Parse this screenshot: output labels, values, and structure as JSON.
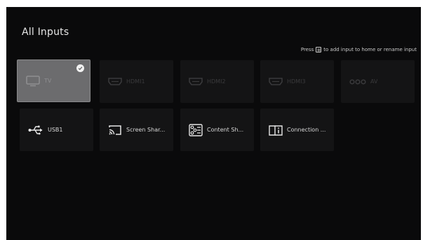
{
  "header": {
    "title": "All Inputs",
    "hint_before": "Press",
    "hint_key_icon": "menu-key-icon",
    "hint_after": "to add input to home or rename input"
  },
  "inputs": [
    {
      "label": "TV",
      "icon": "tv-icon",
      "state": "selected",
      "checked": true
    },
    {
      "label": "HDMI1",
      "icon": "hdmi-icon",
      "state": "disabled"
    },
    {
      "label": "HDMI2",
      "icon": "hdmi-icon",
      "state": "disabled"
    },
    {
      "label": "HDMI3",
      "icon": "hdmi-icon",
      "state": "disabled"
    },
    {
      "label": "AV",
      "icon": "av-icon",
      "state": "disabled"
    },
    {
      "label": "USB1",
      "icon": "usb-icon",
      "state": "enabled"
    },
    {
      "label": "Screen Shar...",
      "icon": "cast-icon",
      "state": "enabled"
    },
    {
      "label": "Content Sh...",
      "icon": "content-share-icon",
      "state": "enabled"
    },
    {
      "label": "Connection ...",
      "icon": "connection-guide-icon",
      "state": "enabled"
    }
  ],
  "colors": {
    "background": "#0a0a0b",
    "tile": "#141415",
    "tile_selected": "#6c6c6e",
    "text": "#d8d8d8"
  }
}
